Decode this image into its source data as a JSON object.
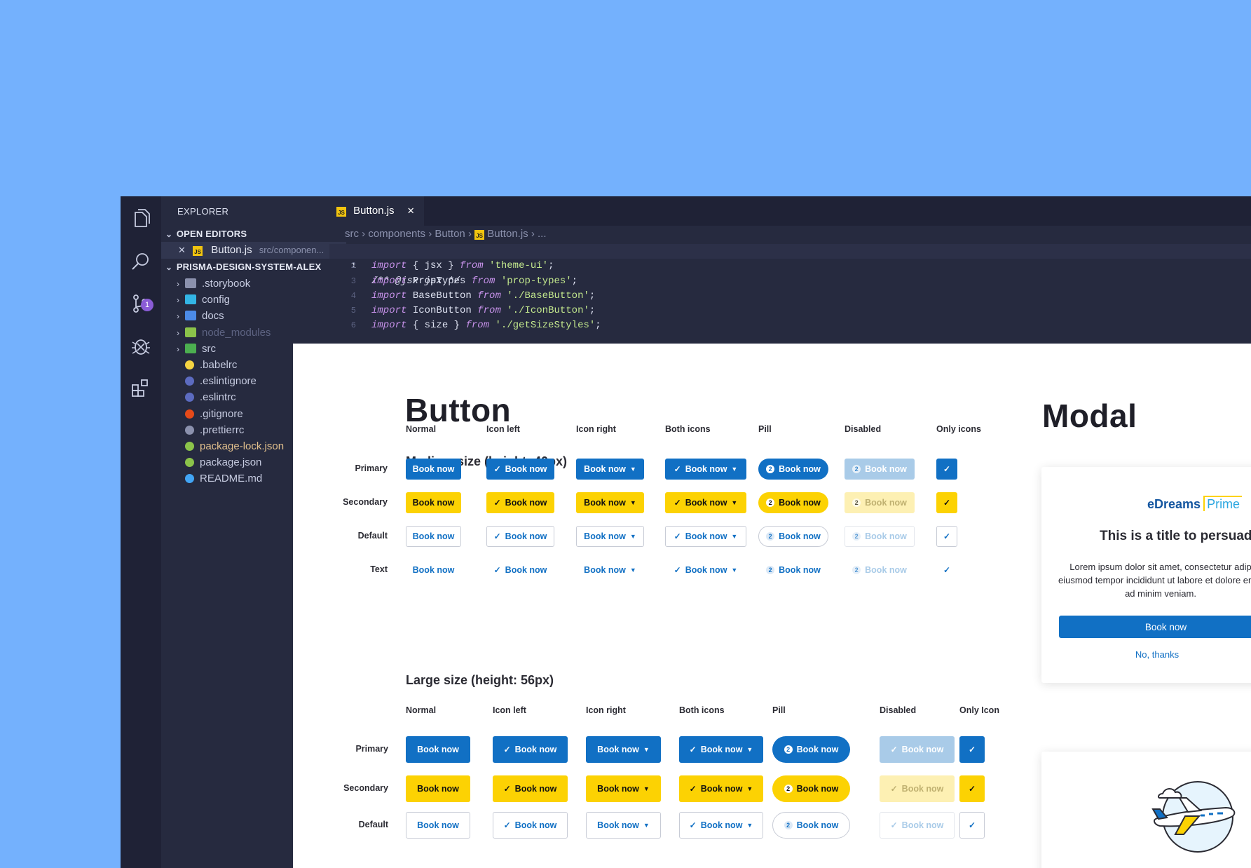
{
  "explorer": {
    "title": "EXPLORER",
    "open_editors_label": "OPEN EDITORS",
    "open_file": "Button.js",
    "open_file_path": "src/componen...",
    "project_label": "PRISMA-DESIGN-SYSTEM-ALEX",
    "items": [
      {
        "label": ".storybook",
        "kind": "folder",
        "color": "#8b91ad"
      },
      {
        "label": "config",
        "kind": "folder",
        "color": "#33b5e5"
      },
      {
        "label": "docs",
        "kind": "folder",
        "color": "#4c8be8"
      },
      {
        "label": "node_modules",
        "kind": "folder",
        "color": "#8bc34a"
      },
      {
        "label": "src",
        "kind": "folder",
        "color": "#4caf50"
      },
      {
        "label": ".babelrc",
        "kind": "file",
        "color": "#f5d442"
      },
      {
        "label": ".eslintignore",
        "kind": "file",
        "color": "#5c6bc0"
      },
      {
        "label": ".eslintrc",
        "kind": "file",
        "color": "#5c6bc0"
      },
      {
        "label": ".gitignore",
        "kind": "file",
        "color": "#e64a19"
      },
      {
        "label": ".prettierrc",
        "kind": "file",
        "color": "#8b91ad"
      },
      {
        "label": "package-lock.json",
        "kind": "file",
        "color": "#8bc34a"
      },
      {
        "label": "package.json",
        "kind": "file",
        "color": "#8bc34a"
      },
      {
        "label": "README.md",
        "kind": "file",
        "color": "#42a5f5"
      }
    ],
    "scm_badge": "1"
  },
  "editor": {
    "tab_label": "Button.js",
    "tab_badge": "JS",
    "breadcrumb": [
      "src",
      "components",
      "Button",
      "Button.js",
      "..."
    ],
    "lines": [
      {
        "n": "1",
        "a": "",
        "b": "/** @jsx jsx */",
        "c": ""
      },
      {
        "n": "2",
        "a": "import",
        "b": " { jsx } ",
        "f": "from",
        "s": " 'theme-ui'",
        "e": ";"
      },
      {
        "n": "3",
        "a": "import",
        "b": " PropTypes ",
        "f": "from",
        "s": " 'prop-types'",
        "e": ";"
      },
      {
        "n": "4",
        "a": "import",
        "b": " BaseButton ",
        "f": "from",
        "s": " './BaseButton'",
        "e": ";"
      },
      {
        "n": "5",
        "a": "import",
        "b": " IconButton ",
        "f": "from",
        "s": " './IconButton'",
        "e": ";"
      },
      {
        "n": "6",
        "a": "import",
        "b": " { size } ",
        "f": "from",
        "s": " './getSizeStyles'",
        "e": ";"
      }
    ]
  },
  "doc": {
    "title": "Button",
    "medium_heading": "Medium size (height: 40px)",
    "large_heading": "Large size (height: 56px)",
    "columns": [
      "Normal",
      "Icon left",
      "Icon right",
      "Both icons",
      "Pill",
      "Disabled",
      "Only icons"
    ],
    "large_columns": [
      "Normal",
      "Icon left",
      "Icon right",
      "Both icons",
      "Pill",
      "Disabled",
      "Only Icon"
    ],
    "rows_medium": [
      "Primary",
      "Secondary",
      "Default",
      "Text"
    ],
    "rows_large": [
      "Primary",
      "Secondary",
      "Default"
    ],
    "button_label": "Book now",
    "pill_number": "2"
  },
  "modal": {
    "heading": "Modal",
    "brand": "eDreams",
    "brand_prime": "Prime",
    "title": "This is a title to persuad",
    "body": "Lorem ipsum dolor sit amet, consectetur adip eiusmod tempor incididunt ut labore et dolore enim ad minim veniam.",
    "primary_label": "Book now",
    "secondary_label": "No, thanks"
  }
}
